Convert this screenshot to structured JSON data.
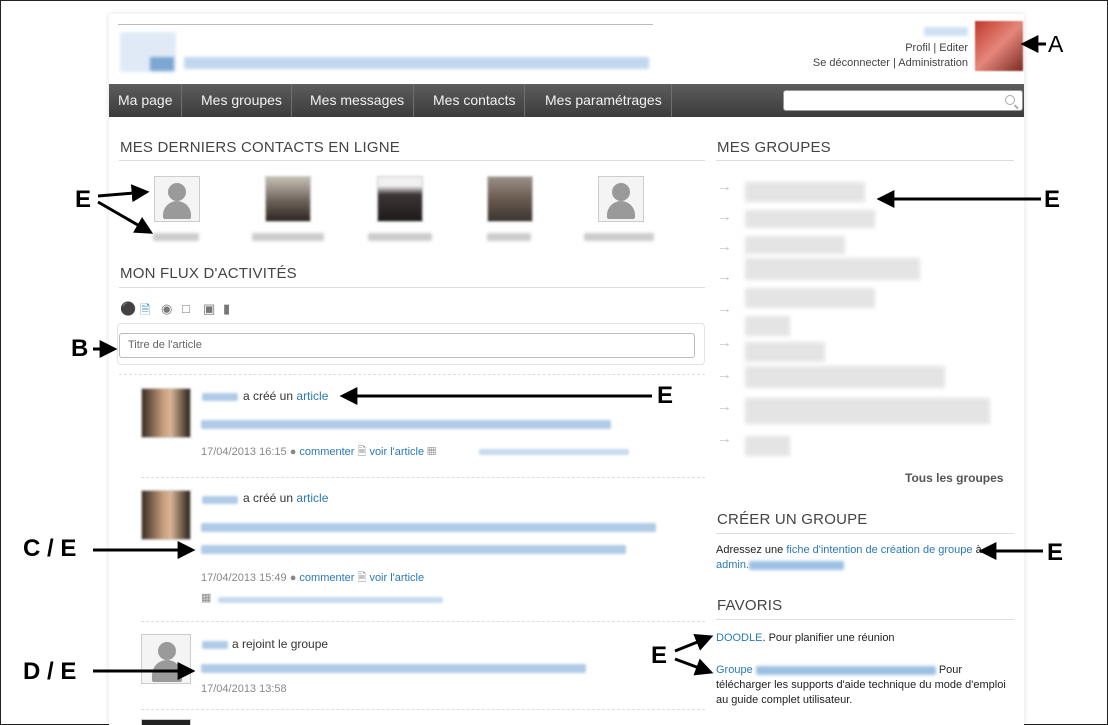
{
  "header": {
    "profil": "Profil",
    "editer": "Editer",
    "deconnecter": "Se déconnecter",
    "administration": "Administration",
    "separator": "|"
  },
  "nav": {
    "items": [
      "Ma page",
      "Mes groupes",
      "Mes messages",
      "Mes contacts",
      "Mes paramétrages"
    ]
  },
  "main": {
    "contacts_title": "MES DERNIERS CONTACTS EN LIGNE",
    "feed_title": "MON FLUX D'ACTIVITÉS",
    "title_placeholder": "Titre de l'article",
    "feed": [
      {
        "verb": "a créé un",
        "object": "article",
        "time": "17/04/2013 16:15",
        "comment": "commenter",
        "view": "voir l'article"
      },
      {
        "verb": "a créé un",
        "object": "article",
        "time": "17/04/2013 15:49",
        "comment": "commenter",
        "view": "voir l'article"
      },
      {
        "verb": "a rejoint le groupe",
        "time": "17/04/2013 13:58"
      }
    ]
  },
  "sidebar": {
    "groups_title": "MES GROUPES",
    "all_groups": "Tous les groupes",
    "create_title": "CRÉER UN GROUPE",
    "create_text_1": "Adressez une",
    "create_link": "fiche d'intention de création de groupe",
    "create_text_2": "à",
    "create_email_prefix": "admin.",
    "favs_title": "FAVORIS",
    "fav1_link": "DOODLE",
    "fav1_text": ". Pour planifier une réunion",
    "fav2_link": "Groupe",
    "fav2_text": "Pour télécharger les supports d'aide technique du mode d'emploi au guide complet utilisateur."
  },
  "annotations": {
    "a": "A",
    "b": "B",
    "c": "C / E",
    "d": "D / E",
    "e": "E"
  }
}
